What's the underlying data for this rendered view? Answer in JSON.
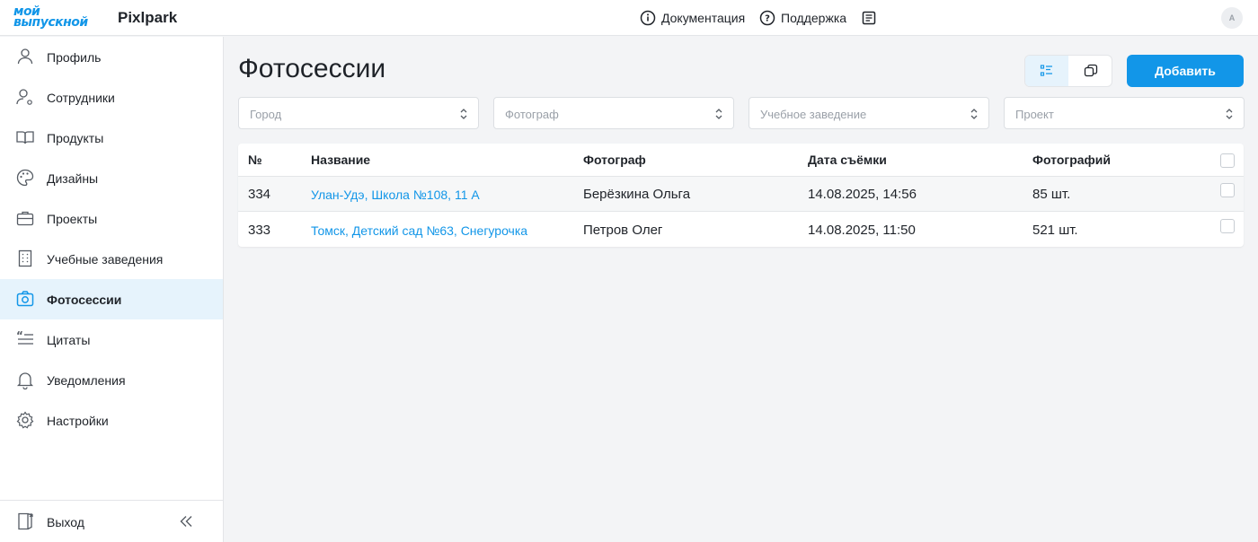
{
  "header": {
    "logo_line1": "мой",
    "logo_line2": "выпускной",
    "brand": "Pixlpark",
    "nav": [
      {
        "label": "Документация",
        "icon": "info-icon"
      },
      {
        "label": "Поддержка",
        "icon": "help-icon"
      }
    ],
    "extra_icon": "news-icon",
    "avatar_initial": "A"
  },
  "sidebar": {
    "items": [
      {
        "label": "Профиль",
        "icon": "user-icon"
      },
      {
        "label": "Сотрудники",
        "icon": "staff-settings-icon"
      },
      {
        "label": "Продукты",
        "icon": "book-open-icon"
      },
      {
        "label": "Дизайны",
        "icon": "palette-icon"
      },
      {
        "label": "Проекты",
        "icon": "briefcase-icon"
      },
      {
        "label": "Учебные заведения",
        "icon": "building-icon"
      },
      {
        "label": "Фотосессии",
        "icon": "camera-icon",
        "active": true
      },
      {
        "label": "Цитаты",
        "icon": "quote-icon"
      },
      {
        "label": "Уведомления",
        "icon": "bell-icon"
      },
      {
        "label": "Настройки",
        "icon": "gear-icon"
      }
    ],
    "logout_label": "Выход"
  },
  "main": {
    "title": "Фотосессии",
    "add_label": "Добавить",
    "filters": [
      {
        "placeholder": "Город"
      },
      {
        "placeholder": "Фотограф"
      },
      {
        "placeholder": "Учебное заведение"
      },
      {
        "placeholder": "Проект"
      }
    ],
    "table": {
      "columns": [
        "№",
        "Название",
        "Фотограф",
        "Дата съёмки",
        "Фотографий"
      ],
      "rows": [
        {
          "num": "334",
          "name": "Улан-Удэ, Школа №108, 11 А",
          "photographer": "Берёзкина Ольга",
          "date": "14.08.2025, 14:56",
          "count": "85 шт."
        },
        {
          "num": "333",
          "name": "Томск, Детский сад №63, Снегурочка",
          "photographer": "Петров Олег",
          "date": "14.08.2025, 11:50",
          "count": "521 шт."
        }
      ]
    }
  },
  "colors": {
    "accent": "#1296e8",
    "active_bg": "#e6f3fc",
    "page_bg": "#f3f4f6"
  }
}
